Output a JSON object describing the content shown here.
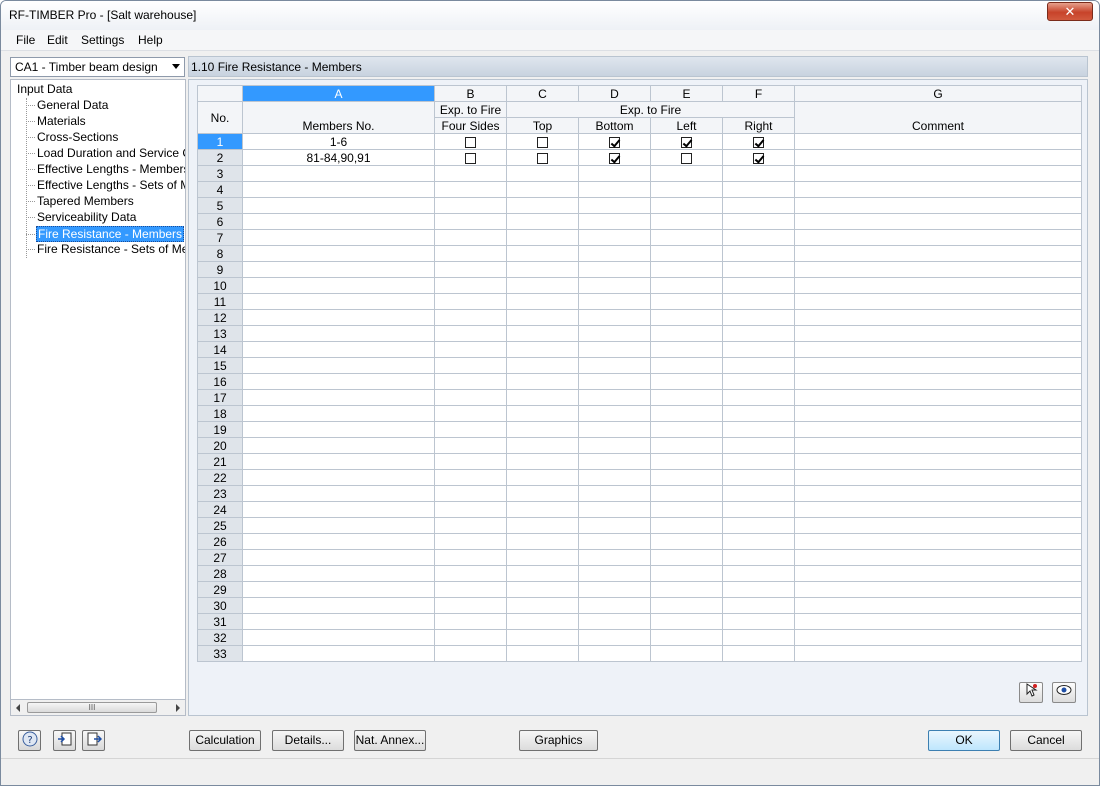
{
  "window": {
    "title": "RF-TIMBER Pro - [Salt warehouse]",
    "close_glyph": "✕"
  },
  "menu": [
    "File",
    "Edit",
    "Settings",
    "Help"
  ],
  "case_select": {
    "value": "CA1 - Timber beam design"
  },
  "tree": {
    "root": "Input Data",
    "items": [
      "General Data",
      "Materials",
      "Cross-Sections",
      "Load Duration and Service Clas",
      "Effective Lengths - Members",
      "Effective Lengths - Sets of Mem",
      "Tapered Members",
      "Serviceability Data",
      "Fire Resistance - Members",
      "Fire Resistance - Sets of Membe"
    ],
    "selected_index": 8
  },
  "scroll_thumb_glyph": "III",
  "panel": {
    "title": "1.10 Fire Resistance - Members",
    "columns": {
      "letters": [
        "A",
        "B",
        "C",
        "D",
        "E",
        "F",
        "G"
      ],
      "no_header": "No.",
      "members_header": "Members No.",
      "b_top": "Exp. to Fire",
      "b_bottom": "Four Sides",
      "cdef_top": "Exp. to Fire",
      "c": "Top",
      "d": "Bottom",
      "e": "Left",
      "f": "Right",
      "g": "Comment"
    },
    "rows": [
      {
        "no": "1",
        "members": "1-6",
        "four_sides": false,
        "top": false,
        "bottom": true,
        "left": true,
        "right": true,
        "comment": ""
      },
      {
        "no": "2",
        "members": "81-84,90,91",
        "four_sides": false,
        "top": false,
        "bottom": true,
        "left": false,
        "right": true,
        "comment": ""
      }
    ],
    "empty_rows": [
      "3",
      "4",
      "5",
      "6",
      "7",
      "8",
      "9",
      "10",
      "11",
      "12",
      "13",
      "14",
      "15",
      "16",
      "17",
      "18",
      "19",
      "20",
      "21",
      "22",
      "23",
      "24",
      "25",
      "26",
      "27",
      "28",
      "29",
      "30",
      "31",
      "32",
      "33"
    ]
  },
  "buttons": {
    "calculation": "Calculation",
    "details": "Details...",
    "nat_annex": "Nat. Annex...",
    "graphics": "Graphics",
    "ok": "OK",
    "cancel": "Cancel"
  }
}
